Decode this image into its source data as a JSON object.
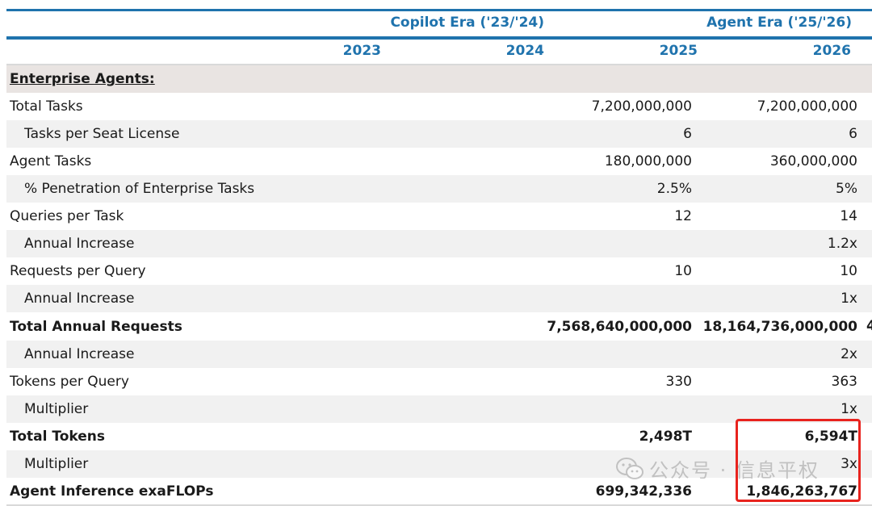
{
  "header": {
    "era_copilot": "Copilot Era ('23/'24)",
    "era_agent": "Agent Era ('25/'26)",
    "years": [
      "2023",
      "2024",
      "2025",
      "2026"
    ]
  },
  "rows": [
    {
      "label": "Enterprise Agents:",
      "y2025": "",
      "y2026": ""
    },
    {
      "label": "Total Tasks",
      "y2025": "7,200,000,000",
      "y2026": "7,200,000,000"
    },
    {
      "label": "Tasks per Seat License",
      "y2025": "6",
      "y2026": "6"
    },
    {
      "label": "Agent Tasks",
      "y2025": "180,000,000",
      "y2026": "360,000,000"
    },
    {
      "label": "% Penetration of Enterprise Tasks",
      "y2025": "2.5%",
      "y2026": "5%"
    },
    {
      "label": "Queries per Task",
      "y2025": "12",
      "y2026": "14"
    },
    {
      "label": "Annual Increase",
      "y2025": "",
      "y2026": "1.2x"
    },
    {
      "label": "Requests per Query",
      "y2025": "10",
      "y2026": "10"
    },
    {
      "label": "Annual Increase",
      "y2025": "",
      "y2026": "1x"
    },
    {
      "label": "Total Annual Requests",
      "y2025": "7,568,640,000,000",
      "y2026": "18,164,736,000,000"
    },
    {
      "label": "Annual Increase",
      "y2025": "",
      "y2026": "2x"
    },
    {
      "label": "Tokens per Query",
      "y2025": "330",
      "y2026": "363"
    },
    {
      "label": "Multiplier",
      "y2025": "",
      "y2026": "1x"
    },
    {
      "label": "Total Tokens",
      "y2025": "2,498T",
      "y2026": "6,594T"
    },
    {
      "label": "Multiplier",
      "y2025": "",
      "y2026": "3x"
    },
    {
      "label": "Agent Inference exaFLOPs",
      "y2025": "699,342,336",
      "y2026": "1,846,263,767"
    }
  ],
  "edge_char": "4",
  "watermark": {
    "text": "公众号 · 信息平权",
    "icon": "wechat-icon"
  },
  "colors": {
    "header_blue": "#1f73ad",
    "input_blue": "#1a1aff",
    "highlight_red": "#e8231e",
    "section_bg": "#e9e4e2",
    "stripe_bg": "#f1f1f1"
  }
}
